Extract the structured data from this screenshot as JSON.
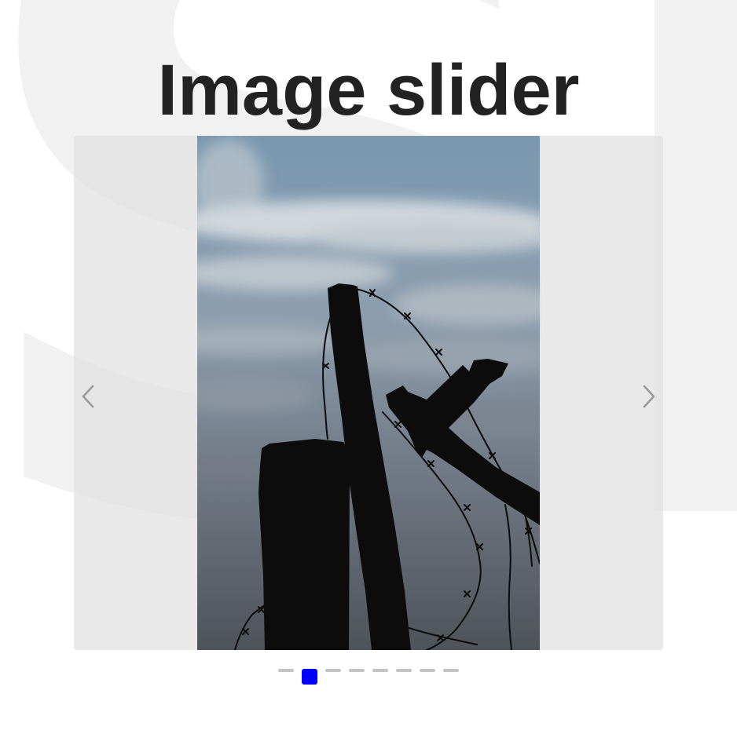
{
  "page": {
    "title": "Image slider",
    "watermark_text": "Sli"
  },
  "slider": {
    "active_index": 1,
    "slide_count": 8,
    "current_image": "silhouette of wooden fence posts with barbed wire against a cloudy sky",
    "prev_icon": "chevron-left-icon",
    "next_icon": "chevron-right-icon"
  },
  "colors": {
    "title": "#222222",
    "watermark": "#f1f1f1",
    "slider_background": "#e6e6e6",
    "arrow": "#9a9a9a",
    "dot_inactive": "#c4c4c4",
    "dot_active": "#0000ff",
    "sky_top": "#7a98b0",
    "sky_bottom": "#4f535a",
    "silhouette": "#0c0c0c"
  }
}
